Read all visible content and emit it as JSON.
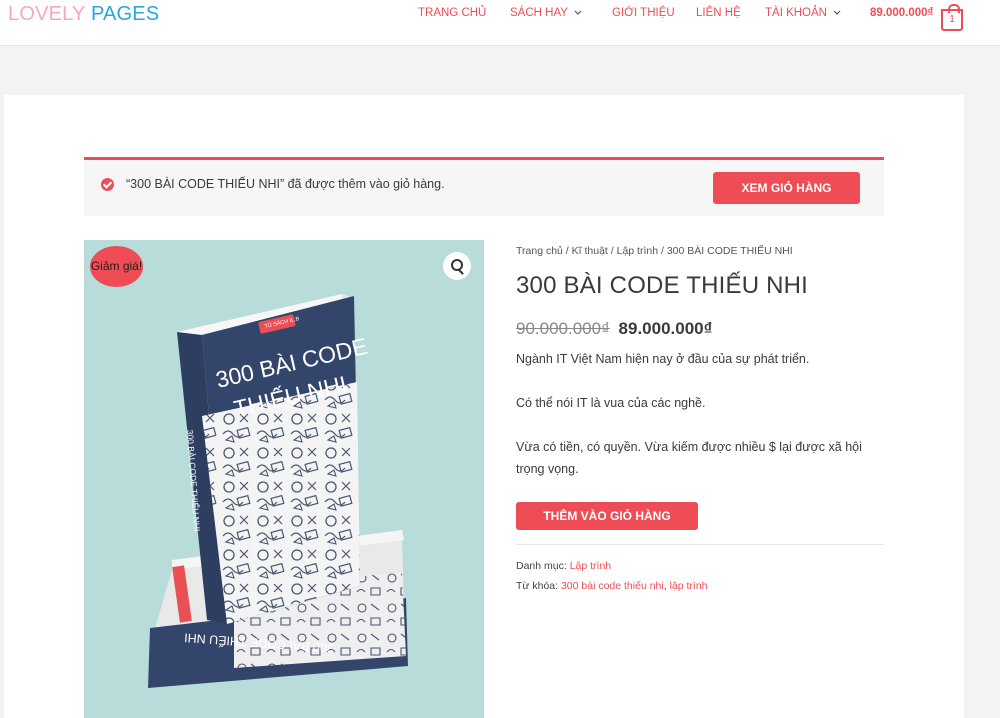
{
  "header": {
    "logo_part1": "LOVELY",
    "logo_part2": "PAGES",
    "nav": [
      {
        "label": "TRANG CHỦ"
      },
      {
        "label": "SÁCH HAY"
      },
      {
        "label": "GIỚI THIỆU"
      },
      {
        "label": "LIÊN HỆ"
      },
      {
        "label": "TÀI KHOẢN"
      }
    ],
    "cart_total": "89.000.000₫",
    "cart_count": "1"
  },
  "notice": {
    "message": "“300 BÀI CODE THIẾU NHI” đã được thêm vào giỏ hàng.",
    "button_label": "XEM GIỎ HÀNG"
  },
  "product": {
    "sale_badge": "Giảm giá!",
    "book_cover_line1": "300 BÀI CODE",
    "book_cover_line2": "THIẾU NHI",
    "book_spine": "300 BÀI CODE THIẾU NHI",
    "book_back": "300 BÀI CODE THIẾU NHI",
    "book_tag": "TỦ SÁCH IL.B",
    "breadcrumb": {
      "home": "Trang chủ",
      "cat1": "Kĩ thuật",
      "cat2": "Lập trình",
      "current": "300 BÀI CODE THIẾU NHI",
      "separator": " / "
    },
    "title": "300 BÀI CODE THIẾU NHI",
    "price_old": "90.000.000₫",
    "price_new": "89.000.000₫",
    "description": [
      "Ngành IT Việt Nam hiện nay ở đầu của sự phát triển.",
      "Có thể nói IT là vua của các nghề.",
      "Vừa có tiền, có quyền. Vừa kiếm được nhiều $ lại được xã hội trọng vọng."
    ],
    "add_to_cart_label": "THÊM VÀO GIỎ HÀNG",
    "category_label": "Danh mục:",
    "category": "Lập trình",
    "tags_label": "Từ khóa:",
    "tags": [
      "300 bài code thiếu nhi",
      "lập trình"
    ],
    "tag_separator": ", "
  },
  "colors": {
    "accent": "#ef4d55",
    "logo_pink": "#f7a6c2",
    "logo_blue": "#29a6e0",
    "book_navy": "#34456b",
    "image_bg": "#b8dcd9"
  }
}
